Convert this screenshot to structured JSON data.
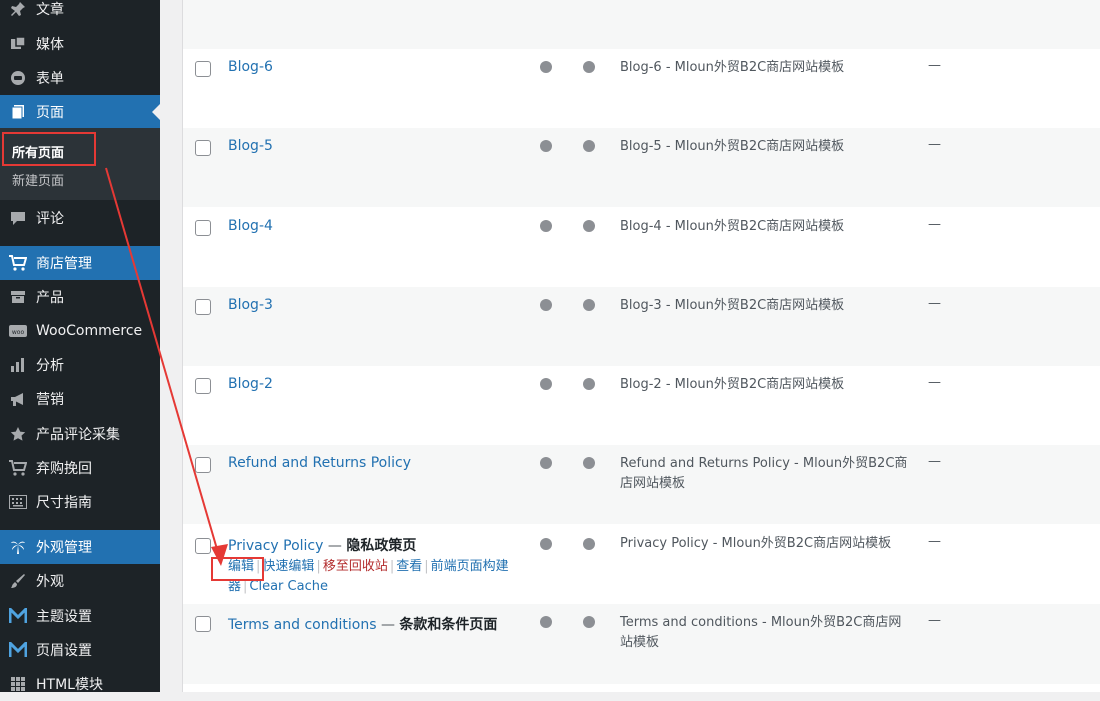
{
  "sidebar": {
    "items": [
      {
        "label": "文章",
        "icon": "pin-icon"
      },
      {
        "label": "媒体",
        "icon": "media-icon"
      },
      {
        "label": "表单",
        "icon": "form-icon"
      },
      {
        "label": "页面",
        "icon": "page-icon"
      },
      {
        "label": "评论",
        "icon": "comment-icon"
      },
      {
        "label": "商店管理",
        "icon": "cart-icon"
      },
      {
        "label": "产品",
        "icon": "archive-icon"
      },
      {
        "label": "WooCommerce",
        "icon": "woo-icon"
      },
      {
        "label": "分析",
        "icon": "chart-icon"
      },
      {
        "label": "营销",
        "icon": "megaphone-icon"
      },
      {
        "label": "产品评论采集",
        "icon": "star-icon"
      },
      {
        "label": "弃购挽回",
        "icon": "cart-icon"
      },
      {
        "label": "尺寸指南",
        "icon": "keyboard-icon"
      },
      {
        "label": "外观管理",
        "icon": "palm-icon"
      },
      {
        "label": "外观",
        "icon": "brush-icon"
      },
      {
        "label": "主题设置",
        "icon": "m-logo-icon"
      },
      {
        "label": "页眉设置",
        "icon": "m-logo-icon"
      },
      {
        "label": "HTML模块",
        "icon": "grid-icon"
      }
    ],
    "submenu": {
      "current": "所有页面",
      "new": "新建页面"
    }
  },
  "pages": [
    {
      "title": "Blog-6",
      "seo": "Blog-6 - Mloun外贸B2C商店网站模板",
      "dash": "—"
    },
    {
      "title": "Blog-5",
      "seo": "Blog-5 - Mloun外贸B2C商店网站模板",
      "dash": "—"
    },
    {
      "title": "Blog-4",
      "seo": "Blog-4 - Mloun外贸B2C商店网站模板",
      "dash": "—"
    },
    {
      "title": "Blog-3",
      "seo": "Blog-3 - Mloun外贸B2C商店网站模板",
      "dash": "—"
    },
    {
      "title": "Blog-2",
      "seo": "Blog-2 - Mloun外贸B2C商店网站模板",
      "dash": "—"
    },
    {
      "title": "Refund and Returns Policy",
      "seo": "Refund and Returns Policy - Mloun外贸B2C商店网站模板",
      "dash": "—"
    },
    {
      "title": "Privacy Policy",
      "sep": " — ",
      "state": "隐私政策页",
      "seo": "Privacy Policy - Mloun外贸B2C商店网站模板",
      "dash": "—"
    },
    {
      "title": "Terms and conditions",
      "sep": " — ",
      "state": "条款和条件页面",
      "seo": "Terms and conditions - Mloun外贸B2C商店网站模板",
      "dash": "—"
    }
  ],
  "row_actions": {
    "edit": "编辑",
    "quick_edit": "快速编辑",
    "trash": "移至回收站",
    "view": "查看",
    "builder": "前端页面构建器",
    "clear_cache": "Clear Cache",
    "pipe": "|"
  },
  "colors": {
    "sidebar": "#1d2327",
    "active": "#2271b1",
    "link": "#2271b1",
    "annotation": "#e53935"
  }
}
